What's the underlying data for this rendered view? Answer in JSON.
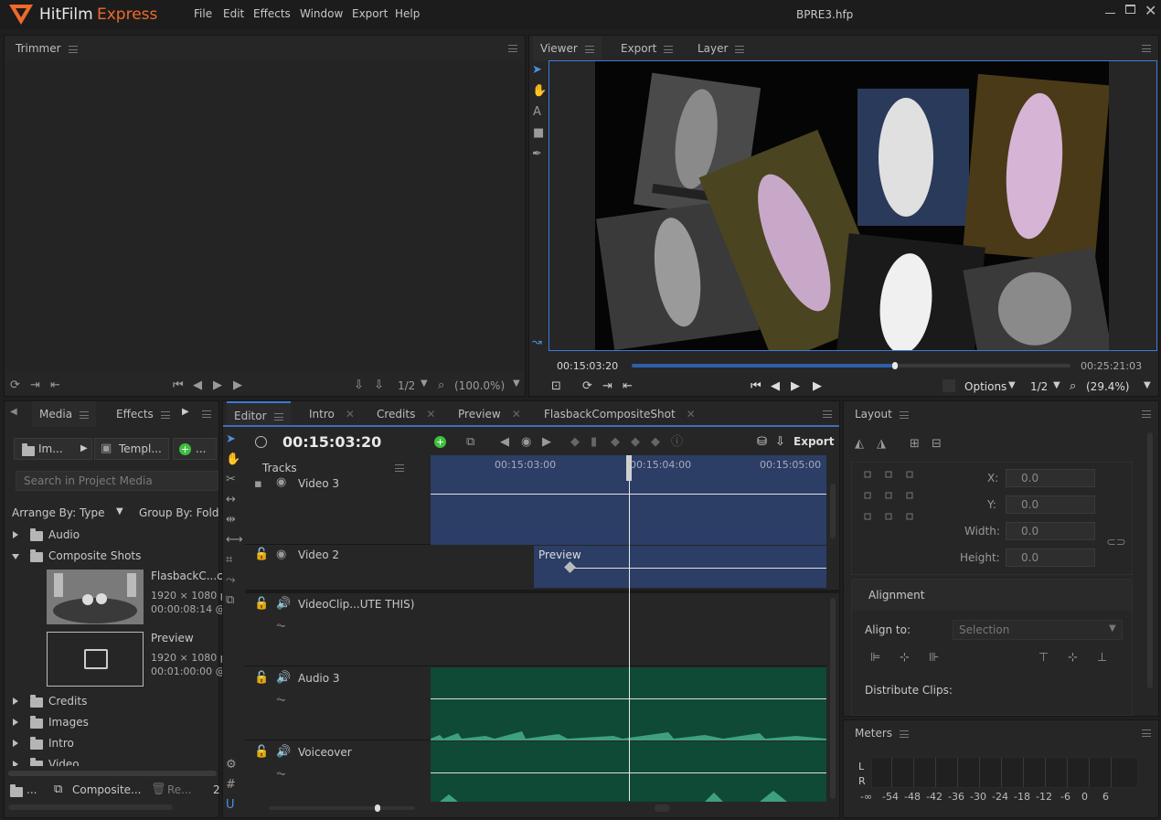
{
  "app": {
    "brand": "HitFilm",
    "brand_suffix": "Express",
    "menu": [
      "File",
      "Edit",
      "Effects",
      "Window",
      "Export",
      "Help"
    ],
    "project_title": "BPRE3.hfp",
    "window_controls": [
      "minimize-icon",
      "maximize-icon",
      "close-icon"
    ]
  },
  "trimmer": {
    "tab": "Trimmer",
    "ratio": "1/2",
    "zoom": "(100.0%)"
  },
  "viewer": {
    "tabs": [
      "Viewer",
      "Export",
      "Layer"
    ],
    "current_time": "00:15:03:20",
    "end_time": "00:25:21:03",
    "progress": 0.6,
    "options_label": "Options",
    "ratio": "1/2",
    "zoom": "(29.4%)"
  },
  "media": {
    "tabs": [
      "Media",
      "Effects"
    ],
    "import_label": "Im...",
    "templates_label": "Templ...",
    "new_label": "...",
    "search_placeholder": "Search in Project Media",
    "arrange_by": "Arrange By: Type",
    "group_by": "Group By: Folde",
    "tree": [
      {
        "label": "Audio",
        "open": false
      },
      {
        "label": "Composite Shots",
        "open": true
      },
      {
        "label": "Credits",
        "open": false
      },
      {
        "label": "Images",
        "open": false
      },
      {
        "label": "Intro",
        "open": false
      },
      {
        "label": "Video",
        "open": false
      }
    ],
    "items": [
      {
        "name": "FlasbackC...c",
        "res": "1920 × 1080 p",
        "dur": "00:00:08:14 @"
      },
      {
        "name": "Preview",
        "res": "1920 × 1080 p",
        "dur": "00:01:00:00 @"
      }
    ],
    "footer": {
      "folder_label": "...",
      "composite_label": "Composite...",
      "remove_label": "Re...",
      "count": "2"
    }
  },
  "editor": {
    "tabs": [
      "Editor",
      "Intro",
      "Credits",
      "Preview",
      "FlasbackCompositeShot"
    ],
    "timecode": "00:15:03:20",
    "export_label": "Export",
    "tracks_label": "Tracks",
    "ruler": [
      "00:15:03:00",
      "00:15:04:00",
      "00:15:05:00"
    ],
    "video_tracks": [
      "Video 3",
      "Video 2"
    ],
    "audio_tracks": [
      "VideoClip...UTE THIS)",
      "Audio 3",
      "Voiceover"
    ],
    "clip_label": "Preview"
  },
  "layout": {
    "tab": "Layout",
    "x_label": "X:",
    "x_value": "0.0",
    "y_label": "Y:",
    "y_value": "0.0",
    "w_label": "Width:",
    "w_value": "0.0",
    "h_label": "Height:",
    "h_value": "0.0",
    "alignment_title": "Alignment",
    "align_to_label": "Align to:",
    "align_to_value": "Selection",
    "distribute_label": "Distribute Clips:"
  },
  "meters": {
    "tab": "Meters",
    "l": "L",
    "r": "R",
    "scale": [
      "-∞",
      "-54",
      "-48",
      "-42",
      "-36",
      "-30",
      "-24",
      "-18",
      "-12",
      "-6",
      "0",
      "6"
    ]
  },
  "colors": {
    "accent": "#f06a2a",
    "video_clip": "#2c3e66",
    "audio_clip": "#0f4a36",
    "selection_blue": "#3b7bd8"
  }
}
